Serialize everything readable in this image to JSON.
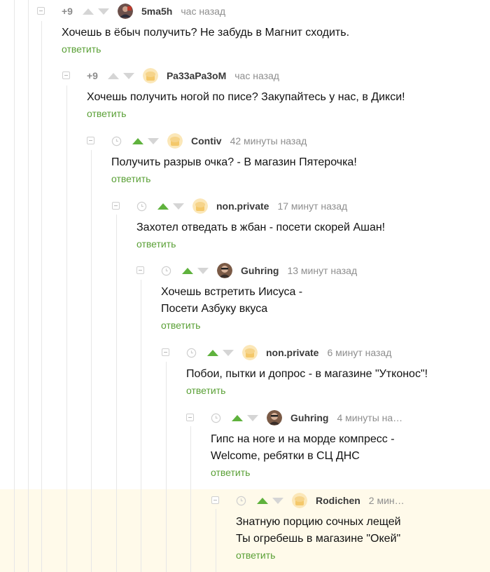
{
  "colors": {
    "accent_green": "#5fb23d",
    "reply_green": "#5aa036",
    "highlight_bg": "#fffaea",
    "thread_line": "#e7e7e7"
  },
  "reply_label": "ответить",
  "comments": [
    {
      "rating": "+9",
      "author": "5ma5h",
      "time": "час назад",
      "avatar": "photo-avatar-icon",
      "lines": [
        "Хочешь в ёбыч получить? Не забудь в Магнит сходить."
      ]
    },
    {
      "rating": "+9",
      "author": "Ра33аРа3оМ",
      "time": "час назад",
      "avatar": "default-bread-avatar-icon",
      "lines": [
        "Хочешь получить ногой по писе? Закупайтесь у нас, в Дикси!"
      ]
    },
    {
      "rating": "",
      "author": "Contiv",
      "time": "42 минуты назад",
      "avatar": "default-bread-avatar-icon",
      "lines": [
        "Получить разрыв очка? - В магазин Пятерочка!"
      ]
    },
    {
      "rating": "",
      "author": "non.private",
      "time": "17 минут назад",
      "avatar": "default-bread-avatar-icon",
      "lines": [
        "Захотел отведать в жбан - посети скорей Ашан!"
      ]
    },
    {
      "rating": "",
      "author": "Guhring",
      "time": "13 минут назад",
      "avatar": "photo-avatar-icon",
      "lines": [
        "Хочешь встретить Иисуса -",
        "Посети Азбуку вкуса"
      ]
    },
    {
      "rating": "",
      "author": "non.private",
      "time": "6 минут назад",
      "avatar": "default-bread-avatar-icon",
      "lines": [
        "Побои, пытки и допрос - в магазине \"Утконос\"!"
      ]
    },
    {
      "rating": "",
      "author": "Guhring",
      "time": "4 минуты на…",
      "avatar": "photo-avatar-icon",
      "lines": [
        "Гипс на ноге и на морде компресс -",
        "Welcome, ребятки в СЦ ДНС"
      ]
    },
    {
      "rating": "",
      "author": "Rodichen",
      "time": "2 мин…",
      "avatar": "default-bread-avatar-icon",
      "lines": [
        "Знатную порцию сочных лещей",
        "Ты огребешь в магазине \"Окей\""
      ]
    }
  ]
}
